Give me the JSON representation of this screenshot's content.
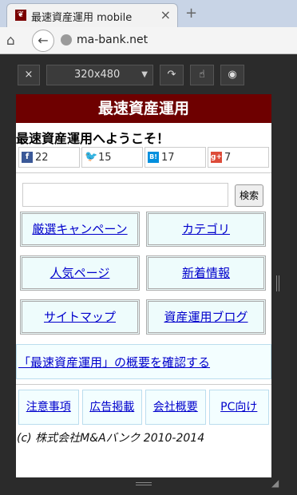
{
  "browser": {
    "tab_title": "最速資産運用 mobile",
    "tab_favicon": "red-plant-icon",
    "tab_close": "×",
    "new_tab": "+",
    "home_icon": "home-icon",
    "back_icon": "back-arrow-icon",
    "url": "ma-bank.net"
  },
  "device_toolbar": {
    "close_label": "×",
    "resolution": "320x480",
    "rotate_icon": "rotate-icon",
    "touch_icon": "touch-icon",
    "screenshot_icon": "camera-icon"
  },
  "site": {
    "header_title": "最速資産運用",
    "welcome": "最速資産運用へようこそ！",
    "social": [
      {
        "icon": "facebook-icon",
        "count": "22"
      },
      {
        "icon": "twitter-icon",
        "count": "15"
      },
      {
        "icon": "hatena-bookmark-icon",
        "count": "17"
      },
      {
        "icon": "google-plus-icon",
        "count": "7"
      }
    ],
    "search_placeholder": "",
    "search_button": "検索",
    "nav": [
      "厳選キャンペーン",
      "カテゴリ",
      "人気ページ",
      "新着情報",
      "サイトマップ",
      "資産運用ブログ"
    ],
    "summary_link": "「最速資産運用」の概要を確認する",
    "footer_nav": [
      "注意事項",
      "広告掲載",
      "会社概要",
      "PC向け"
    ],
    "copyright": "(c) 株式会社M&Aバンク 2010-2014"
  },
  "colors": {
    "header_bg": "#6e0000",
    "link": "#0000cc",
    "button_bg": "#eefcfc"
  }
}
